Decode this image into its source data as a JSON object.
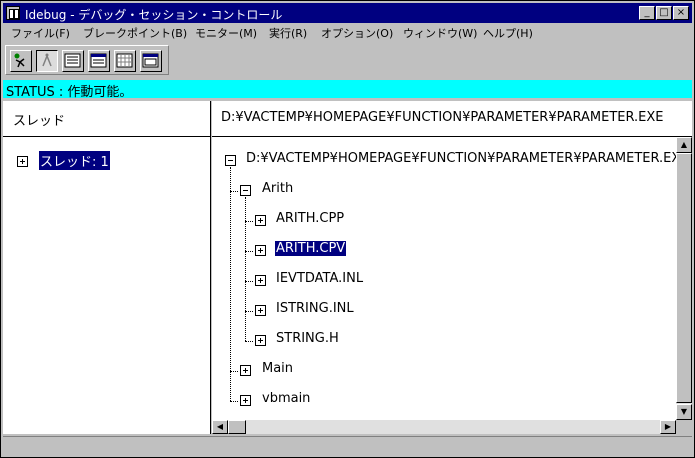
{
  "window": {
    "title": "Idebug - デバッグ・セッション・コントロール",
    "buttons": {
      "minimize": "_",
      "maximize": "□",
      "close": "×"
    }
  },
  "menu": [
    "ファイル(F)",
    "ブレークポイント(B)",
    "モニター(M)",
    "実行(R)",
    "オプション(O)",
    "ウィンドウ(W)",
    "ヘルプ(H)"
  ],
  "toolbar": [
    "run-icon",
    "step-icon",
    "source-view-icon",
    "list-view-icon",
    "grid-view-icon",
    "monitor-view-icon"
  ],
  "status": {
    "text": "STATUS : 作動可能。"
  },
  "threads": {
    "header": "スレッド",
    "items": [
      {
        "label": "スレッド: 1",
        "selected": true
      }
    ]
  },
  "files": {
    "header": "D:¥VACTEMP¥HOMEPAGE¥FUNCTION¥PARAMETER¥PARAMETER.EXE",
    "tree": {
      "root": "D:¥VACTEMP¥HOMEPAGE¥FUNCTION¥PARAMETER¥PARAMETER.EXE",
      "arith": "Arith",
      "arith_children": [
        "ARITH.CPP",
        "ARITH.CPV",
        "IEVTDATA.INL",
        "ISTRING.INL",
        "STRING.H"
      ],
      "main": "Main",
      "vbmain": "vbmain"
    }
  },
  "colors": {
    "titlebar": "#000080",
    "status_bg": "#00ffff",
    "selection": "#000080"
  }
}
